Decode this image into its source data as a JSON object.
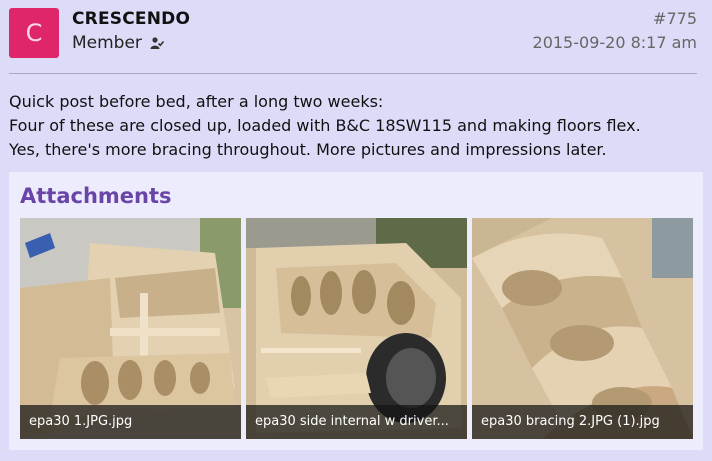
{
  "post": {
    "author": {
      "avatar_letter": "C",
      "avatar_color": "#e0266a",
      "name": "CRESCENDO",
      "role": "Member",
      "role_icon": "user-check-icon"
    },
    "number": "#775",
    "date": "2015-09-20 8:17 am",
    "body_lines": [
      "Quick post before bed, after a long two weeks:",
      "Four of these are closed up, loaded with B&C 18SW115 and making floors flex.",
      "Yes, there's more bracing throughout. More pictures and impressions later."
    ]
  },
  "attachments": {
    "title": "Attachments",
    "title_color": "#6a45a8",
    "items": [
      {
        "caption": "epa30 1.JPG.jpg"
      },
      {
        "caption": "epa30 side internal w driver..."
      },
      {
        "caption": "epa30 bracing 2.JPG (1).jpg"
      }
    ]
  }
}
